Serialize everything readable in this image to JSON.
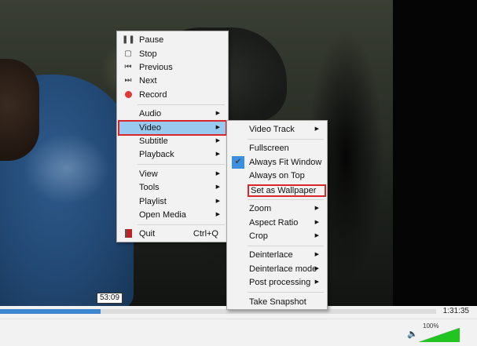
{
  "player": {
    "current_time": "53:09",
    "total_time": "1:31:35",
    "progress": 0.23,
    "volume_label": "100%",
    "volume_level": 1.0,
    "accent_color": "#3d86cf",
    "volume_color": "#22c422"
  },
  "main_menu": {
    "items": [
      {
        "label": "Pause",
        "icon": "pause-icon"
      },
      {
        "label": "Stop",
        "icon": "stop-icon"
      },
      {
        "label": "Previous",
        "icon": "previous-icon"
      },
      {
        "label": "Next",
        "icon": "next-icon"
      },
      {
        "label": "Record",
        "icon": "record-icon"
      },
      {
        "label": "Audio",
        "submenu": true
      },
      {
        "label": "Video",
        "submenu": true,
        "highlighted": true
      },
      {
        "label": "Subtitle",
        "submenu": true
      },
      {
        "label": "Playback",
        "submenu": true
      },
      {
        "label": "View",
        "submenu": true
      },
      {
        "label": "Tools",
        "submenu": true
      },
      {
        "label": "Playlist",
        "submenu": true
      },
      {
        "label": "Open Media",
        "submenu": true
      },
      {
        "label": "Quit",
        "icon": "quit-icon",
        "shortcut": "Ctrl+Q"
      }
    ]
  },
  "video_menu": {
    "items": [
      {
        "label": "Video Track",
        "submenu": true
      },
      {
        "label": "Fullscreen"
      },
      {
        "label": "Always Fit Window",
        "checked": true
      },
      {
        "label": "Always on Top"
      },
      {
        "label": "Set as Wallpaper",
        "highlighted_box": true
      },
      {
        "label": "Zoom",
        "submenu": true
      },
      {
        "label": "Aspect Ratio",
        "submenu": true
      },
      {
        "label": "Crop",
        "submenu": true
      },
      {
        "label": "Deinterlace",
        "submenu": true
      },
      {
        "label": "Deinterlace mode",
        "submenu": true
      },
      {
        "label": "Post processing",
        "submenu": true
      },
      {
        "label": "Take Snapshot"
      }
    ]
  }
}
